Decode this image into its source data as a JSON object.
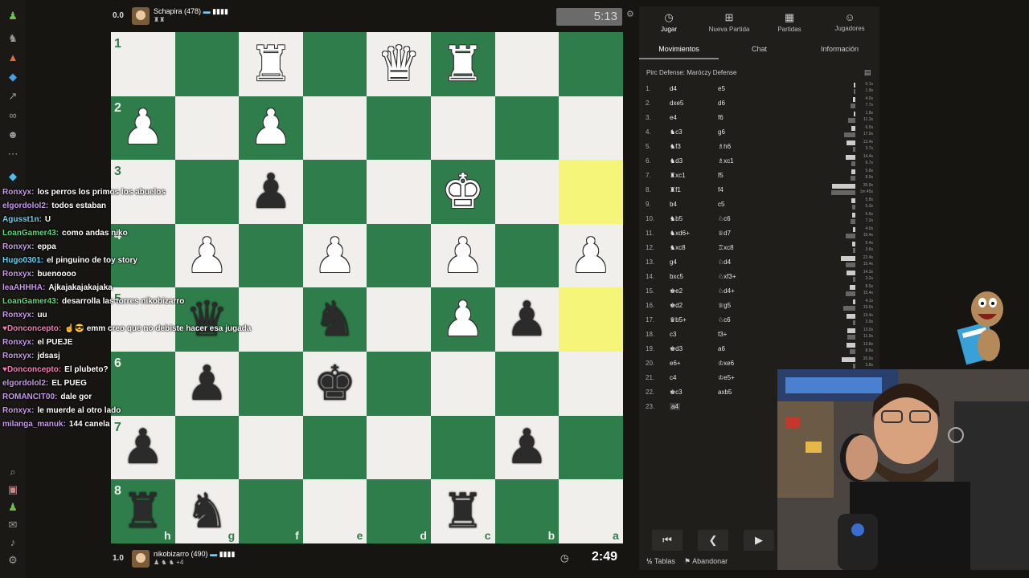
{
  "top_player": {
    "score": "0.0",
    "name": "Schapira",
    "rating": "(478)",
    "tags": "♜♜",
    "clock": "5:13"
  },
  "bottom_player": {
    "score": "1.0",
    "name": "nikobizarro",
    "rating": "(490)",
    "tags": "♟ ♞ ♞ +4",
    "clock": "2:49"
  },
  "chat": [
    {
      "user": "Ronxyx:",
      "msg": "los perros los primos los abuelos",
      "color": "#c59be6"
    },
    {
      "user": "elgordolol2:",
      "msg": "todos estaban",
      "color": "#c59be6"
    },
    {
      "user": "Agusst1n:",
      "msg": "U",
      "color": "#5fd3f5"
    },
    {
      "user": "LoanGamer43:",
      "msg": "como andas niko",
      "color": "#5fd37a"
    },
    {
      "user": "Ronxyx:",
      "msg": "eppa",
      "color": "#c59be6"
    },
    {
      "user": "Hugo0301:",
      "msg": "el pinguino de toy story",
      "color": "#5fd3f5"
    },
    {
      "user": "Ronxyx:",
      "msg": "buenoooo",
      "color": "#c59be6"
    },
    {
      "user": "leaAHHHA:",
      "msg": "Ajkajakajakajaka",
      "color": "#c59be6"
    },
    {
      "user": "LoanGamer43:",
      "msg": "desarrolla las torres nikobizarro",
      "color": "#5fd37a"
    },
    {
      "user": "Ronxyx:",
      "msg": "uu",
      "color": "#c59be6"
    },
    {
      "user": "♥Donconcepto:",
      "msg": "☝😎 emm creo que no debiste hacer esa jugada",
      "color": "#f07fb0"
    },
    {
      "user": "Ronxyx:",
      "msg": "el PUEJE",
      "color": "#c59be6"
    },
    {
      "user": "Ronxyx:",
      "msg": "jdsasj",
      "color": "#c59be6"
    },
    {
      "user": "♥Donconcepto:",
      "msg": "El plubeto?",
      "color": "#f07fb0"
    },
    {
      "user": "elgordolol2:",
      "msg": "EL PUEG",
      "color": "#c59be6"
    },
    {
      "user": "ROMANCIT00:",
      "msg": "dale gor",
      "color": "#c59be6"
    },
    {
      "user": "Ronxyx:",
      "msg": "le muerde al otro lado",
      "color": "#c59be6"
    },
    {
      "user": "milanga_manuk:",
      "msg": "144 canela",
      "color": "#c59be6"
    }
  ],
  "board": {
    "ranks": [
      "1",
      "2",
      "3",
      "4",
      "5",
      "6",
      "7",
      "8"
    ],
    "files": [
      "h",
      "g",
      "f",
      "e",
      "d",
      "c",
      "b",
      "a"
    ],
    "highlight": [
      "2-7",
      "4-7"
    ],
    "pieces": [
      {
        "r": 0,
        "c": 2,
        "p": "♜",
        "col": "w"
      },
      {
        "r": 0,
        "c": 4,
        "p": "♛",
        "col": "w"
      },
      {
        "r": 0,
        "c": 5,
        "p": "♜",
        "col": "w"
      },
      {
        "r": 1,
        "c": 0,
        "p": "♟",
        "col": "w"
      },
      {
        "r": 1,
        "c": 2,
        "p": "♟",
        "col": "w"
      },
      {
        "r": 2,
        "c": 2,
        "p": "♟",
        "col": "b"
      },
      {
        "r": 2,
        "c": 5,
        "p": "♚",
        "col": "w"
      },
      {
        "r": 3,
        "c": 1,
        "p": "♟",
        "col": "w"
      },
      {
        "r": 3,
        "c": 3,
        "p": "♟",
        "col": "w"
      },
      {
        "r": 3,
        "c": 5,
        "p": "♟",
        "col": "w"
      },
      {
        "r": 3,
        "c": 7,
        "p": "♟",
        "col": "w"
      },
      {
        "r": 4,
        "c": 1,
        "p": "♛",
        "col": "b"
      },
      {
        "r": 4,
        "c": 3,
        "p": "♞",
        "col": "b"
      },
      {
        "r": 4,
        "c": 5,
        "p": "♟",
        "col": "w"
      },
      {
        "r": 4,
        "c": 6,
        "p": "♟",
        "col": "b"
      },
      {
        "r": 5,
        "c": 1,
        "p": "♟",
        "col": "b"
      },
      {
        "r": 5,
        "c": 3,
        "p": "♚",
        "col": "b"
      },
      {
        "r": 6,
        "c": 0,
        "p": "♟",
        "col": "b"
      },
      {
        "r": 6,
        "c": 6,
        "p": "♟",
        "col": "b"
      },
      {
        "r": 7,
        "c": 0,
        "p": "♜",
        "col": "b"
      },
      {
        "r": 7,
        "c": 1,
        "p": "♞",
        "col": "b"
      },
      {
        "r": 7,
        "c": 5,
        "p": "♜",
        "col": "b"
      }
    ]
  },
  "panel": {
    "nav": [
      {
        "label": "Jugar",
        "icon": "◷"
      },
      {
        "label": "Nueva Partida",
        "icon": "⊞"
      },
      {
        "label": "Partidas",
        "icon": "▦"
      },
      {
        "label": "Jugadores",
        "icon": "☺"
      }
    ],
    "tabs": [
      "Movimientos",
      "Chat",
      "Información"
    ],
    "opening": "Pirc Defense: Maróczy Defense",
    "moves": [
      {
        "n": "1.",
        "w": "d4",
        "b": "e5",
        "tw": "0.1s",
        "tb": "1.9s"
      },
      {
        "n": "2.",
        "w": "dxe5",
        "b": "d6",
        "tw": "4.0s",
        "tb": "7.7s"
      },
      {
        "n": "3.",
        "w": "e4",
        "b": "f6",
        "tw": "1.8s",
        "tb": "11.3s"
      },
      {
        "n": "4.",
        "w": "♞c3",
        "b": "g6",
        "tw": "6.0s",
        "tb": "17.9s"
      },
      {
        "n": "5.",
        "w": "♞f3",
        "b": "♗h6",
        "tw": "13.4s",
        "tb": "3.7s"
      },
      {
        "n": "6.",
        "w": "♞d3",
        "b": "♗xc1",
        "tw": "14.4s",
        "tb": "6.7s"
      },
      {
        "n": "7.",
        "w": "♜xc1",
        "b": "f5",
        "tw": "5.8s",
        "tb": "8.0s"
      },
      {
        "n": "8.",
        "w": "♜f1",
        "b": "f4",
        "tw": "35.9s",
        "tb": "1m 45s"
      },
      {
        "n": "9.",
        "w": "b4",
        "b": "c5",
        "tw": "5.8s",
        "tb": "5.3s"
      },
      {
        "n": "10.",
        "w": "♞b5",
        "b": "♘c6",
        "tw": "5.6s",
        "tb": "7.2s"
      },
      {
        "n": "11.",
        "w": "♞xd6+",
        "b": "♕d7",
        "tw": "4.0s",
        "tb": "15.4s"
      },
      {
        "n": "12.",
        "w": "♞xc8",
        "b": "♖xc8",
        "tw": "5.4s",
        "tb": "3.6s"
      },
      {
        "n": "13.",
        "w": "g4",
        "b": "♘d4",
        "tw": "22.4s",
        "tb": "15.4s"
      },
      {
        "n": "14.",
        "w": "bxc5",
        "b": "♘xf3+",
        "tw": "14.3s",
        "tb": "3.2s"
      },
      {
        "n": "15.",
        "w": "♚e2",
        "b": "♘d4+",
        "tw": "8.5s",
        "tb": "15.4s"
      },
      {
        "n": "16.",
        "w": "♚d2",
        "b": "♕g5",
        "tw": "4.1s",
        "tb": "19.0s"
      },
      {
        "n": "17.",
        "w": "♛b5+",
        "b": "♘c6",
        "tw": "13.4s",
        "tb": "3.9s"
      },
      {
        "n": "18.",
        "w": "c3",
        "b": "f3+",
        "tw": "13.0s",
        "tb": "11.9s"
      },
      {
        "n": "19.",
        "w": "♚d3",
        "b": "a6",
        "tw": "13.8s",
        "tb": "8.6s"
      },
      {
        "n": "20.",
        "w": "e6+",
        "b": "♔xe6",
        "tw": "20.9s",
        "tb": "3.8s"
      },
      {
        "n": "21.",
        "w": "c4",
        "b": "♔e5+",
        "tw": "",
        "tb": ""
      },
      {
        "n": "22.",
        "w": "♚c3",
        "b": "axb5",
        "tw": "",
        "tb": ""
      },
      {
        "n": "23.",
        "w": "a4",
        "b": "",
        "tw": "",
        "tb": ""
      }
    ],
    "controls": [
      "⏮",
      "❮",
      "▶"
    ],
    "actions": {
      "draw": "Tablas",
      "resign": "Abandonar"
    }
  }
}
